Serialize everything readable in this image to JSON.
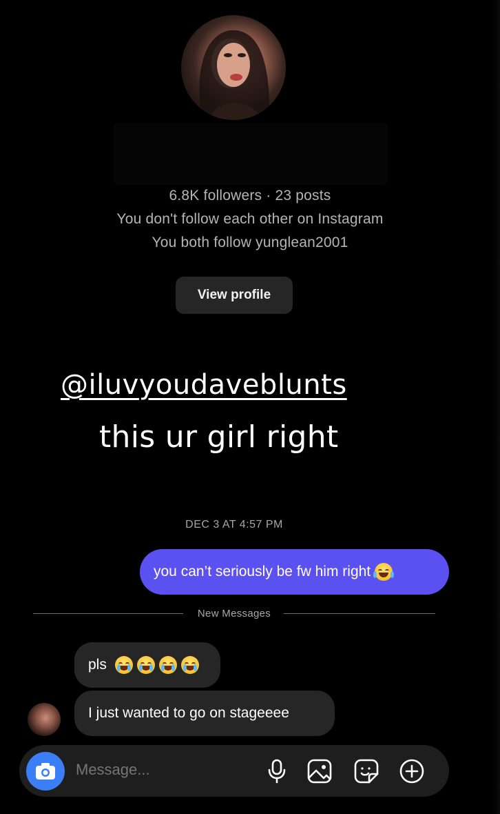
{
  "profile": {
    "stats": "6.8K followers · 23 posts",
    "follow_status": "You don't follow each other on Instagram",
    "mutual": "You both follow yunglean2001",
    "view_profile_label": "View profile"
  },
  "story": {
    "mention": "@iluvyoudaveblunts",
    "caption": "this ur girl right"
  },
  "thread": {
    "timestamp": "DEC 3 AT 4:57 PM",
    "sent_message": "you can’t seriously be fw him right",
    "sent_emoji": "face-with-tears-of-joy",
    "divider_label": "New Messages",
    "received": [
      {
        "text": "pls",
        "emoji": [
          "loudly-crying-face",
          "loudly-crying-face",
          "loudly-crying-face",
          "loudly-crying-face"
        ]
      },
      {
        "text": "I just wanted to go on stageeee"
      }
    ]
  },
  "composer": {
    "placeholder": "Message...",
    "icons": [
      "camera-icon",
      "microphone-icon",
      "gallery-icon",
      "sticker-icon",
      "plus-icon"
    ]
  },
  "colors": {
    "background": "#000000",
    "sent_bubble": "#5b51f0",
    "received_bubble": "#262626",
    "camera_button": "#3a7ff6"
  }
}
